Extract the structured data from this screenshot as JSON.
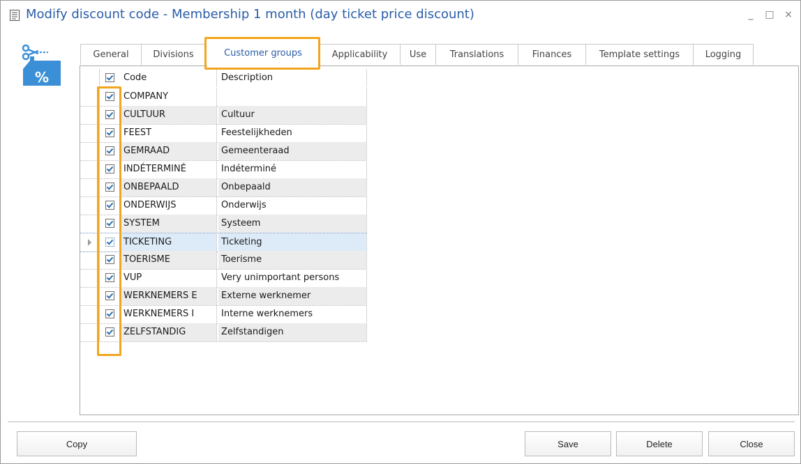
{
  "window": {
    "title": "Modify discount code - Membership 1 month (day ticket price discount)",
    "minimize_glyph": "_",
    "maximize_glyph": "□",
    "close_glyph": "×"
  },
  "tabs": [
    {
      "label": "General"
    },
    {
      "label": "Divisions"
    },
    {
      "label": "Customer groups",
      "active": true
    },
    {
      "label": "Applicability"
    },
    {
      "label": "Use"
    },
    {
      "label": "Translations"
    },
    {
      "label": "Finances"
    },
    {
      "label": "Template settings"
    },
    {
      "label": "Logging"
    }
  ],
  "grid": {
    "columns": {
      "code": "Code",
      "description": "Description"
    },
    "header_checked": true,
    "rows": [
      {
        "code": "COMPANY",
        "description": "",
        "checked": true
      },
      {
        "code": "CULTUUR",
        "description": "Cultuur",
        "checked": true
      },
      {
        "code": "FEEST",
        "description": "Feestelijkheden",
        "checked": true
      },
      {
        "code": "GEMRAAD",
        "description": "Gemeenteraad",
        "checked": true
      },
      {
        "code": "INDÉTERMINÉ",
        "description": "Indéterminé",
        "checked": true
      },
      {
        "code": "ONBEPAALD",
        "description": "Onbepaald",
        "checked": true
      },
      {
        "code": "ONDERWIJS",
        "description": "Onderwijs",
        "checked": true
      },
      {
        "code": "SYSTEM",
        "description": "Systeem",
        "checked": true
      },
      {
        "code": "TICKETING",
        "description": "Ticketing",
        "checked": true,
        "selected": true
      },
      {
        "code": "TOERISME",
        "description": "Toerisme",
        "checked": true
      },
      {
        "code": "VUP",
        "description": "Very unimportant persons",
        "checked": true
      },
      {
        "code": "WERKNEMERS E",
        "description": "Externe werknemer",
        "checked": true
      },
      {
        "code": "WERKNEMERS I",
        "description": "Interne werknemers",
        "checked": true
      },
      {
        "code": "ZELFSTANDIG",
        "description": "Zelfstandigen",
        "checked": true
      }
    ]
  },
  "buttons": {
    "copy": "Copy",
    "save": "Save",
    "delete": "Delete",
    "close": "Close"
  },
  "colors": {
    "title_text": "#2a5da8",
    "highlight": "#f2a51c",
    "checkbox_mark": "#2b6cb0",
    "selected_row": "#ddeaf7",
    "app_icon_blue": "#3a8fd6"
  },
  "icons": {
    "title": "form-icon",
    "app": "discount-scissors-percent-icon",
    "checkbox": "checkmark-icon",
    "row_indicator": "triangle-right-icon"
  }
}
